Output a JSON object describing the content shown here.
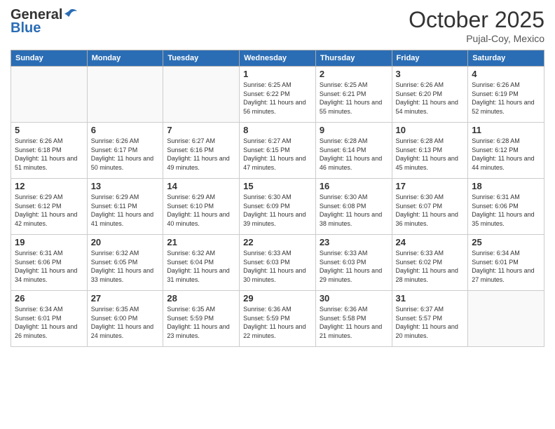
{
  "header": {
    "logo_general": "General",
    "logo_blue": "Blue",
    "month_title": "October 2025",
    "subtitle": "Pujal-Coy, Mexico"
  },
  "days_of_week": [
    "Sunday",
    "Monday",
    "Tuesday",
    "Wednesday",
    "Thursday",
    "Friday",
    "Saturday"
  ],
  "weeks": [
    [
      {
        "day": "",
        "empty": true
      },
      {
        "day": "",
        "empty": true
      },
      {
        "day": "",
        "empty": true
      },
      {
        "day": "1",
        "sunrise": "6:25 AM",
        "sunset": "6:22 PM",
        "daylight": "11 hours and 56 minutes."
      },
      {
        "day": "2",
        "sunrise": "6:25 AM",
        "sunset": "6:21 PM",
        "daylight": "11 hours and 55 minutes."
      },
      {
        "day": "3",
        "sunrise": "6:26 AM",
        "sunset": "6:20 PM",
        "daylight": "11 hours and 54 minutes."
      },
      {
        "day": "4",
        "sunrise": "6:26 AM",
        "sunset": "6:19 PM",
        "daylight": "11 hours and 52 minutes."
      }
    ],
    [
      {
        "day": "5",
        "sunrise": "6:26 AM",
        "sunset": "6:18 PM",
        "daylight": "11 hours and 51 minutes."
      },
      {
        "day": "6",
        "sunrise": "6:26 AM",
        "sunset": "6:17 PM",
        "daylight": "11 hours and 50 minutes."
      },
      {
        "day": "7",
        "sunrise": "6:27 AM",
        "sunset": "6:16 PM",
        "daylight": "11 hours and 49 minutes."
      },
      {
        "day": "8",
        "sunrise": "6:27 AM",
        "sunset": "6:15 PM",
        "daylight": "11 hours and 47 minutes."
      },
      {
        "day": "9",
        "sunrise": "6:28 AM",
        "sunset": "6:14 PM",
        "daylight": "11 hours and 46 minutes."
      },
      {
        "day": "10",
        "sunrise": "6:28 AM",
        "sunset": "6:13 PM",
        "daylight": "11 hours and 45 minutes."
      },
      {
        "day": "11",
        "sunrise": "6:28 AM",
        "sunset": "6:12 PM",
        "daylight": "11 hours and 44 minutes."
      }
    ],
    [
      {
        "day": "12",
        "sunrise": "6:29 AM",
        "sunset": "6:12 PM",
        "daylight": "11 hours and 42 minutes."
      },
      {
        "day": "13",
        "sunrise": "6:29 AM",
        "sunset": "6:11 PM",
        "daylight": "11 hours and 41 minutes."
      },
      {
        "day": "14",
        "sunrise": "6:29 AM",
        "sunset": "6:10 PM",
        "daylight": "11 hours and 40 minutes."
      },
      {
        "day": "15",
        "sunrise": "6:30 AM",
        "sunset": "6:09 PM",
        "daylight": "11 hours and 39 minutes."
      },
      {
        "day": "16",
        "sunrise": "6:30 AM",
        "sunset": "6:08 PM",
        "daylight": "11 hours and 38 minutes."
      },
      {
        "day": "17",
        "sunrise": "6:30 AM",
        "sunset": "6:07 PM",
        "daylight": "11 hours and 36 minutes."
      },
      {
        "day": "18",
        "sunrise": "6:31 AM",
        "sunset": "6:06 PM",
        "daylight": "11 hours and 35 minutes."
      }
    ],
    [
      {
        "day": "19",
        "sunrise": "6:31 AM",
        "sunset": "6:06 PM",
        "daylight": "11 hours and 34 minutes."
      },
      {
        "day": "20",
        "sunrise": "6:32 AM",
        "sunset": "6:05 PM",
        "daylight": "11 hours and 33 minutes."
      },
      {
        "day": "21",
        "sunrise": "6:32 AM",
        "sunset": "6:04 PM",
        "daylight": "11 hours and 31 minutes."
      },
      {
        "day": "22",
        "sunrise": "6:33 AM",
        "sunset": "6:03 PM",
        "daylight": "11 hours and 30 minutes."
      },
      {
        "day": "23",
        "sunrise": "6:33 AM",
        "sunset": "6:03 PM",
        "daylight": "11 hours and 29 minutes."
      },
      {
        "day": "24",
        "sunrise": "6:33 AM",
        "sunset": "6:02 PM",
        "daylight": "11 hours and 28 minutes."
      },
      {
        "day": "25",
        "sunrise": "6:34 AM",
        "sunset": "6:01 PM",
        "daylight": "11 hours and 27 minutes."
      }
    ],
    [
      {
        "day": "26",
        "sunrise": "6:34 AM",
        "sunset": "6:01 PM",
        "daylight": "11 hours and 26 minutes."
      },
      {
        "day": "27",
        "sunrise": "6:35 AM",
        "sunset": "6:00 PM",
        "daylight": "11 hours and 24 minutes."
      },
      {
        "day": "28",
        "sunrise": "6:35 AM",
        "sunset": "5:59 PM",
        "daylight": "11 hours and 23 minutes."
      },
      {
        "day": "29",
        "sunrise": "6:36 AM",
        "sunset": "5:59 PM",
        "daylight": "11 hours and 22 minutes."
      },
      {
        "day": "30",
        "sunrise": "6:36 AM",
        "sunset": "5:58 PM",
        "daylight": "11 hours and 21 minutes."
      },
      {
        "day": "31",
        "sunrise": "6:37 AM",
        "sunset": "5:57 PM",
        "daylight": "11 hours and 20 minutes."
      },
      {
        "day": "",
        "empty": true
      }
    ]
  ],
  "labels": {
    "sunrise": "Sunrise:",
    "sunset": "Sunset:",
    "daylight": "Daylight:"
  }
}
